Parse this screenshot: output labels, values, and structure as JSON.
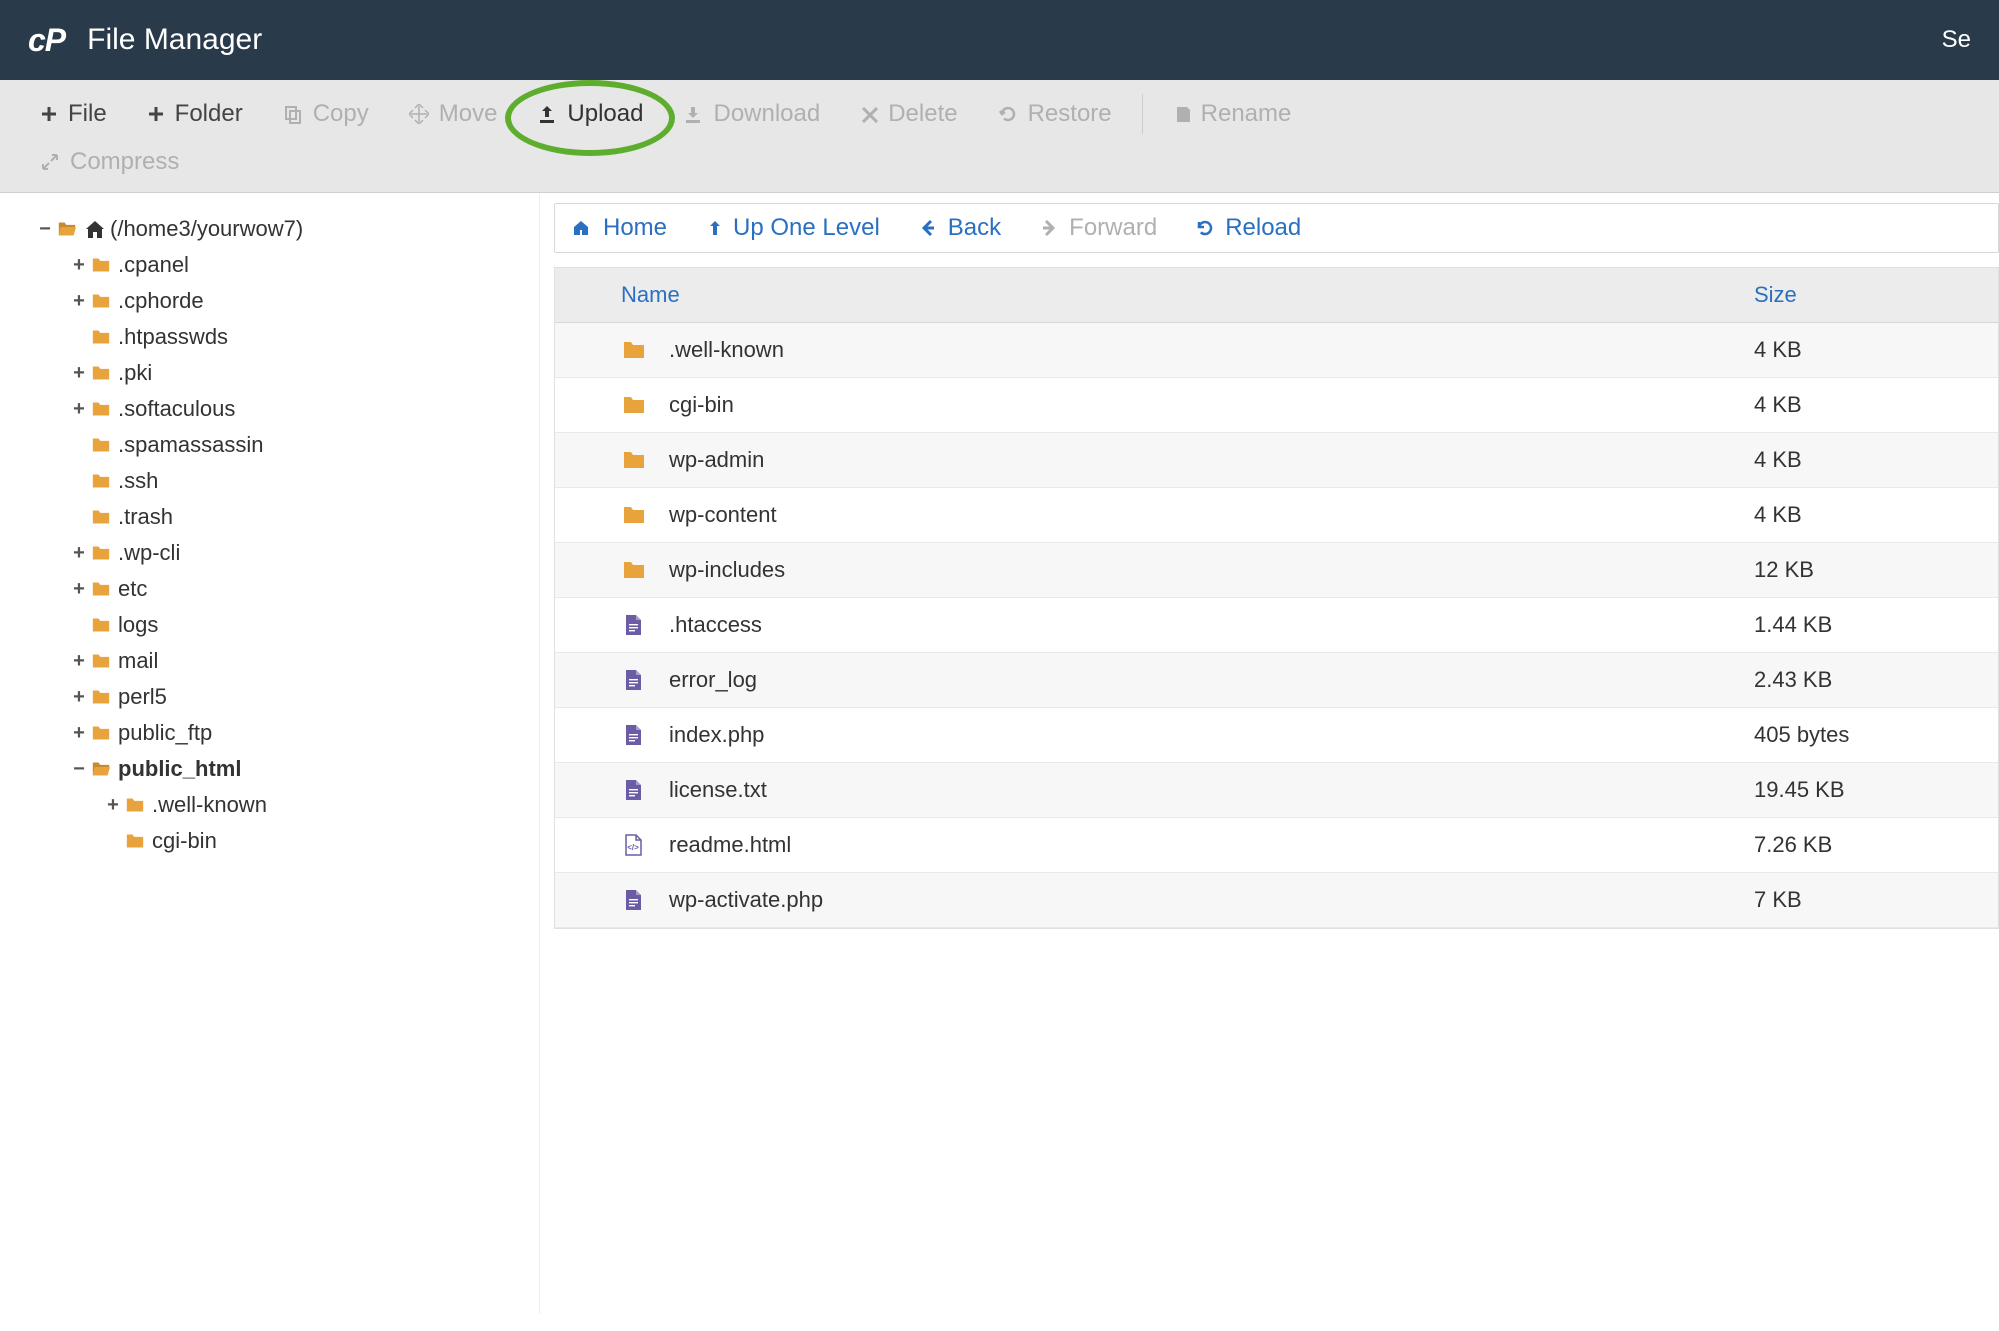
{
  "header": {
    "app_title": "File Manager",
    "right_text": "Se"
  },
  "toolbar": {
    "file": "File",
    "folder": "Folder",
    "copy": "Copy",
    "move": "Move",
    "upload": "Upload",
    "download": "Download",
    "delete": "Delete",
    "restore": "Restore",
    "rename": "Rename",
    "compress": "Compress"
  },
  "nav": {
    "home": "Home",
    "up": "Up One Level",
    "back": "Back",
    "forward": "Forward",
    "reload": "Reload"
  },
  "tree": {
    "root": "(/home3/yourwow7)",
    "items": [
      {
        "label": ".cpanel",
        "depth": 2,
        "twisty": "+"
      },
      {
        "label": ".cphorde",
        "depth": 2,
        "twisty": "+"
      },
      {
        "label": ".htpasswds",
        "depth": 2,
        "twisty": ""
      },
      {
        "label": ".pki",
        "depth": 2,
        "twisty": "+"
      },
      {
        "label": ".softaculous",
        "depth": 2,
        "twisty": "+"
      },
      {
        "label": ".spamassassin",
        "depth": 2,
        "twisty": ""
      },
      {
        "label": ".ssh",
        "depth": 2,
        "twisty": ""
      },
      {
        "label": ".trash",
        "depth": 2,
        "twisty": ""
      },
      {
        "label": ".wp-cli",
        "depth": 2,
        "twisty": "+"
      },
      {
        "label": "etc",
        "depth": 2,
        "twisty": "+"
      },
      {
        "label": "logs",
        "depth": 2,
        "twisty": ""
      },
      {
        "label": "mail",
        "depth": 2,
        "twisty": "+"
      },
      {
        "label": "perl5",
        "depth": 2,
        "twisty": "+"
      },
      {
        "label": "public_ftp",
        "depth": 2,
        "twisty": "+"
      },
      {
        "label": "public_html",
        "depth": 2,
        "twisty": "−",
        "bold": true
      },
      {
        "label": ".well-known",
        "depth": 3,
        "twisty": "+"
      },
      {
        "label": "cgi-bin",
        "depth": 3,
        "twisty": ""
      }
    ]
  },
  "table": {
    "columns": {
      "name": "Name",
      "size": "Size"
    },
    "rows": [
      {
        "name": ".well-known",
        "size": "4 KB",
        "type": "folder"
      },
      {
        "name": "cgi-bin",
        "size": "4 KB",
        "type": "folder"
      },
      {
        "name": "wp-admin",
        "size": "4 KB",
        "type": "folder"
      },
      {
        "name": "wp-content",
        "size": "4 KB",
        "type": "folder"
      },
      {
        "name": "wp-includes",
        "size": "12 KB",
        "type": "folder"
      },
      {
        "name": ".htaccess",
        "size": "1.44 KB",
        "type": "file"
      },
      {
        "name": "error_log",
        "size": "2.43 KB",
        "type": "file"
      },
      {
        "name": "index.php",
        "size": "405 bytes",
        "type": "file"
      },
      {
        "name": "license.txt",
        "size": "19.45 KB",
        "type": "file"
      },
      {
        "name": "readme.html",
        "size": "7.26 KB",
        "type": "html"
      },
      {
        "name": "wp-activate.php",
        "size": "7 KB",
        "type": "file"
      }
    ]
  }
}
